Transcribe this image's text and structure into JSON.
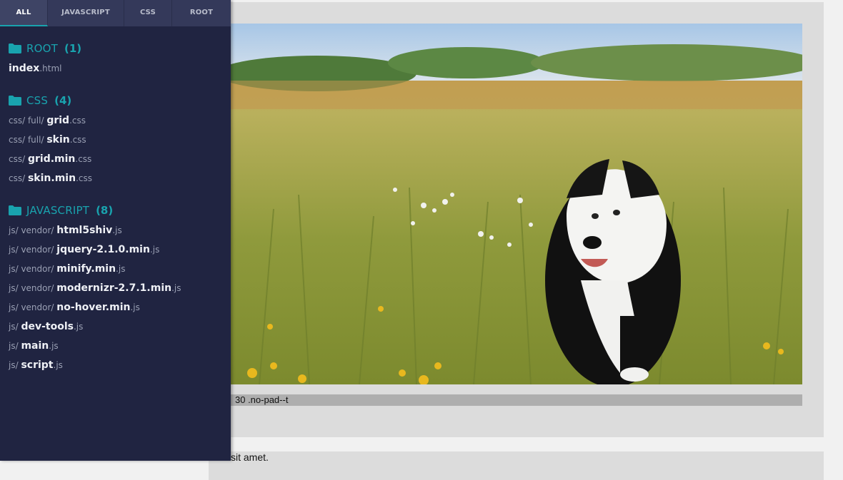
{
  "tabs": [
    {
      "label": "ALL",
      "active": true
    },
    {
      "label": "JAVASCRIPT",
      "active": false
    },
    {
      "label": "CSS",
      "active": false
    },
    {
      "label": "ROOT",
      "active": false
    }
  ],
  "groups": [
    {
      "name": "ROOT",
      "count": "(1)",
      "files": [
        {
          "path": "",
          "name": "index",
          "ext": ".html"
        }
      ]
    },
    {
      "name": "CSS",
      "count": "(4)",
      "files": [
        {
          "path": "css/ full/ ",
          "name": "grid",
          "ext": ".css"
        },
        {
          "path": "css/ full/ ",
          "name": "skin",
          "ext": ".css"
        },
        {
          "path": "css/ ",
          "name": "grid.min",
          "ext": ".css"
        },
        {
          "path": "css/ ",
          "name": "skin.min",
          "ext": ".css"
        }
      ]
    },
    {
      "name": "JAVASCRIPT",
      "count": "(8)",
      "files": [
        {
          "path": "js/ vendor/ ",
          "name": "html5shiv",
          "ext": ".js"
        },
        {
          "path": "js/ vendor/ ",
          "name": "jquery-2.1.0.min",
          "ext": ".js"
        },
        {
          "path": "js/ vendor/ ",
          "name": "minify.min",
          "ext": ".js"
        },
        {
          "path": "js/ vendor/ ",
          "name": "modernizr-2.7.1.min",
          "ext": ".js"
        },
        {
          "path": "js/ vendor/ ",
          "name": "no-hover.min",
          "ext": ".js"
        },
        {
          "path": "js/ ",
          "name": "dev-tools",
          "ext": ".js"
        },
        {
          "path": "js/ ",
          "name": "main",
          "ext": ".js"
        },
        {
          "path": "js/ ",
          "name": "script",
          "ext": ".js"
        }
      ]
    }
  ],
  "content": {
    "caption": "30 .no-pad--t",
    "next_text": "sit amet."
  },
  "colors": {
    "sidebar_bg": "#202441",
    "tab_bar_bg": "#34395a",
    "accent": "#19a3ae"
  },
  "icons": {
    "folder": "folder-icon"
  }
}
